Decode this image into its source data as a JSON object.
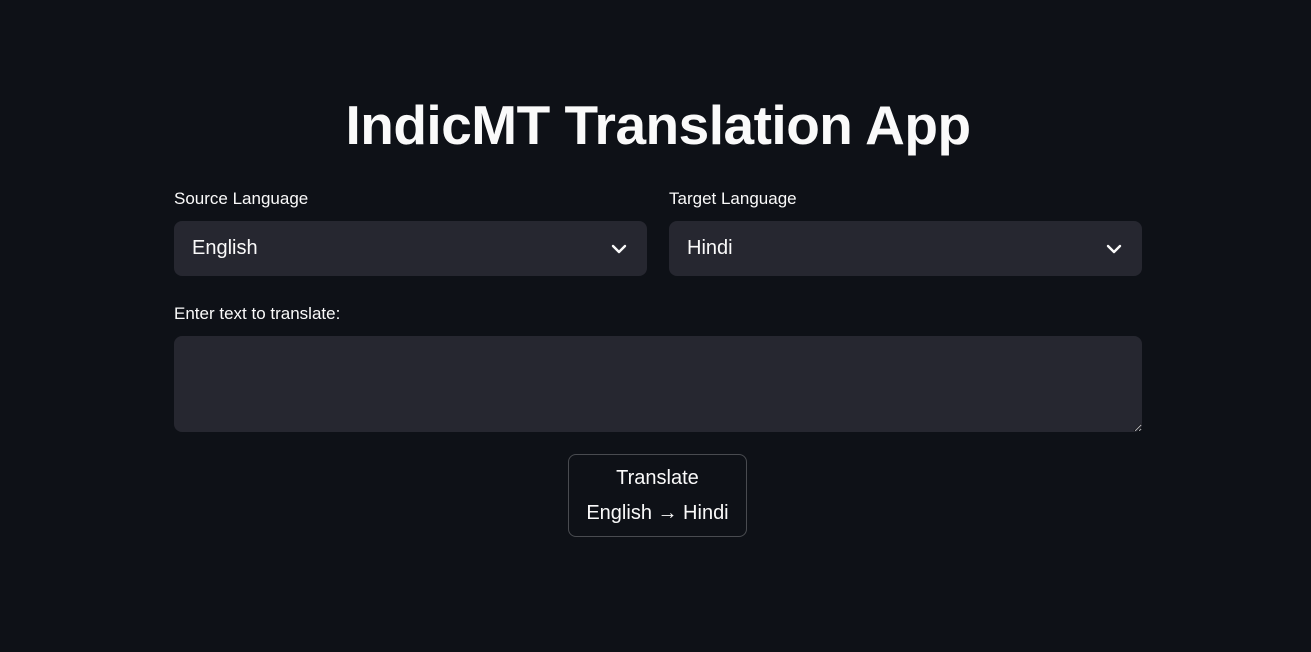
{
  "app": {
    "title": "IndicMT Translation App"
  },
  "source": {
    "label": "Source Language",
    "value": "English"
  },
  "target": {
    "label": "Target Language",
    "value": "Hindi"
  },
  "input": {
    "label": "Enter text to translate:",
    "value": ""
  },
  "translate_button": {
    "line1": "Translate",
    "line2": "English → Hindi"
  },
  "icons": {
    "dropdown": "chevron-down-icon",
    "resize": "resize-handle-icon"
  },
  "colors": {
    "background": "#0e1117",
    "field": "#262730",
    "text": "#fafafa"
  }
}
